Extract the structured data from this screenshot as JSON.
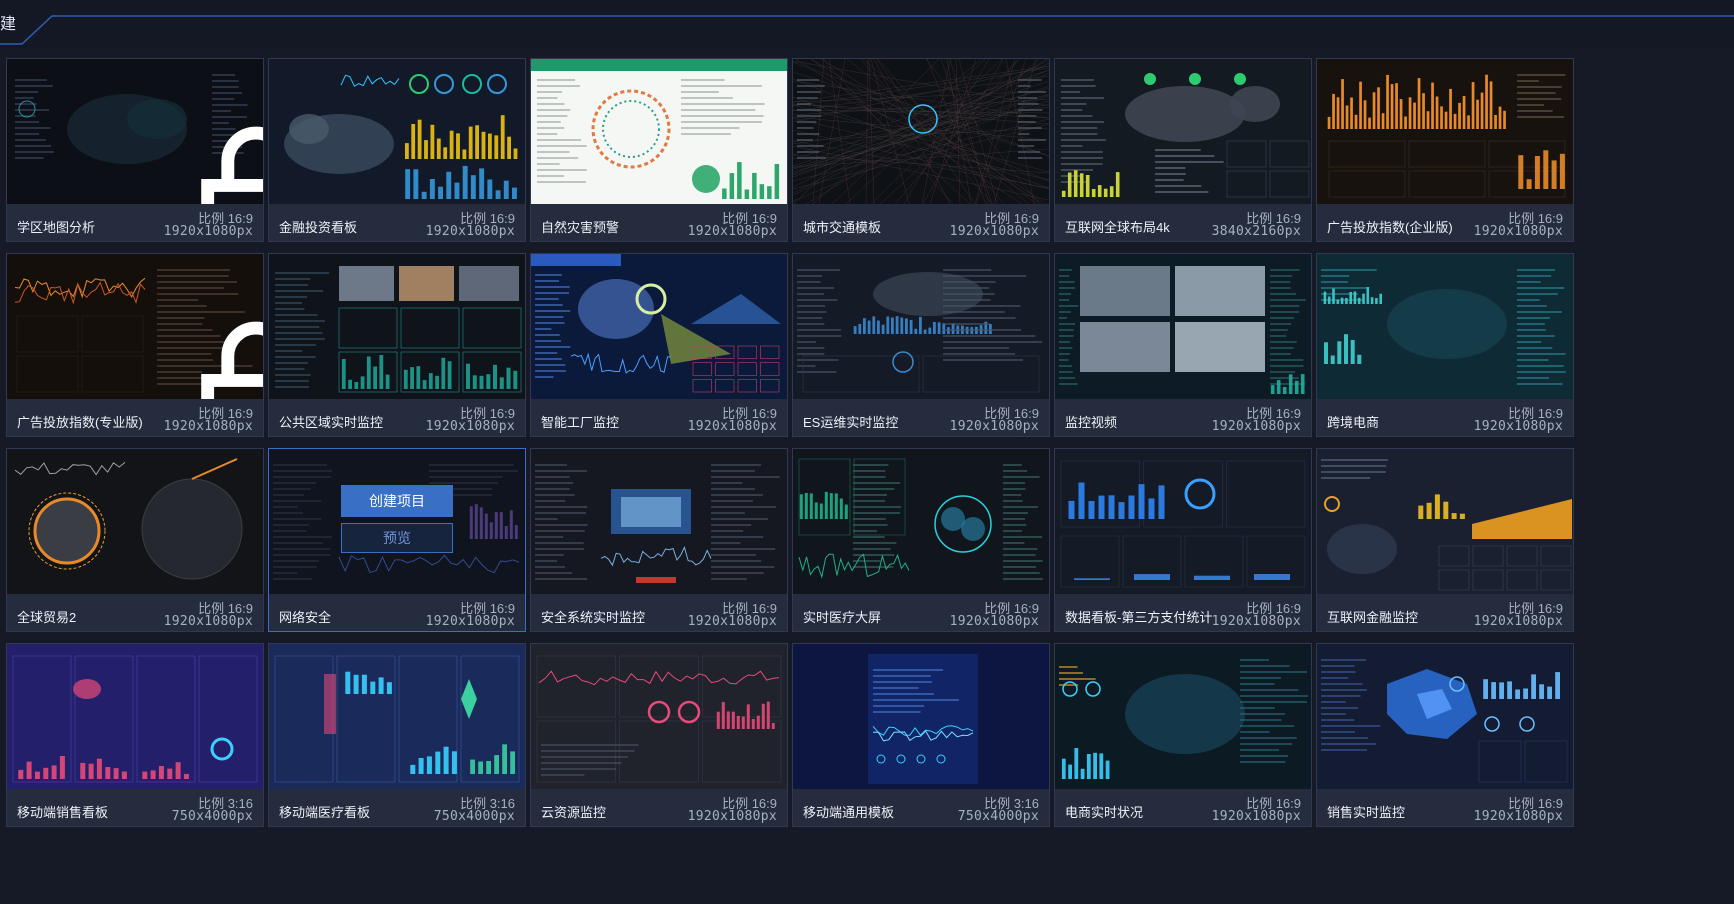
{
  "header": {
    "partial_char": "建"
  },
  "cards": [
    {
      "title": "学区地图分析",
      "ratio": "比例 16:9",
      "size": "1920x1080px",
      "locked": true,
      "theme": "dark-map"
    },
    {
      "title": "金融投资看板",
      "ratio": "比例 16:9",
      "size": "1920x1080px",
      "locked": false,
      "theme": "finance"
    },
    {
      "title": "自然灾害预警",
      "ratio": "比例 16:9",
      "size": "1920x1080px",
      "locked": false,
      "theme": "light-green"
    },
    {
      "title": "城市交通模板",
      "ratio": "比例 16:9",
      "size": "1920x1080px",
      "locked": false,
      "theme": "city-map"
    },
    {
      "title": "互联网全球布局4k",
      "ratio": "比例 16:9",
      "size": "3840x2160px",
      "locked": false,
      "theme": "world-dark"
    },
    {
      "title": "广告投放指数(企业版)",
      "ratio": "比例 16:9",
      "size": "1920x1080px",
      "locked": false,
      "theme": "orange-bars"
    },
    {
      "title": "广告投放指数(专业版)",
      "ratio": "比例 16:9",
      "size": "1920x1080px",
      "locked": true,
      "theme": "orange-line"
    },
    {
      "title": "公共区域实时监控",
      "ratio": "比例 16:9",
      "size": "1920x1080px",
      "locked": false,
      "theme": "cctv"
    },
    {
      "title": "智能工厂监控",
      "ratio": "比例 16:9",
      "size": "1920x1080px",
      "locked": false,
      "theme": "factory"
    },
    {
      "title": "ES运维实时监控",
      "ratio": "比例 16:9",
      "size": "1920x1080px",
      "locked": false,
      "theme": "es-ops"
    },
    {
      "title": "监控视频",
      "ratio": "比例 16:9",
      "size": "1920x1080px",
      "locked": false,
      "theme": "video"
    },
    {
      "title": "跨境电商",
      "ratio": "比例 16:9",
      "size": "1920x1080px",
      "locked": false,
      "theme": "teal-map"
    },
    {
      "title": "全球贸易2",
      "ratio": "比例 16:9",
      "size": "1920x1080px",
      "locked": false,
      "theme": "globe"
    },
    {
      "title": "网络安全",
      "ratio": "比例 16:9",
      "size": "1920x1080px",
      "locked": false,
      "theme": "security",
      "hover": true
    },
    {
      "title": "安全系统实时监控",
      "ratio": "比例 16:9",
      "size": "1920x1080px",
      "locked": false,
      "theme": "secsys"
    },
    {
      "title": "实时医疗大屏",
      "ratio": "比例 16:9",
      "size": "1920x1080px",
      "locked": false,
      "theme": "brain"
    },
    {
      "title": "数据看板-第三方支付统计",
      "ratio": "比例 16:9",
      "size": "1920x1080px",
      "locked": false,
      "theme": "payment"
    },
    {
      "title": "互联网金融监控",
      "ratio": "比例 16:9",
      "size": "1920x1080px",
      "locked": false,
      "theme": "fintech"
    },
    {
      "title": "移动端销售看板",
      "ratio": "比例 3:16",
      "size": "750x4000px",
      "locked": false,
      "theme": "mobile-sales"
    },
    {
      "title": "移动端医疗看板",
      "ratio": "比例 3:16",
      "size": "750x4000px",
      "locked": false,
      "theme": "mobile-med"
    },
    {
      "title": "云资源监控",
      "ratio": "比例 16:9",
      "size": "1920x1080px",
      "locked": false,
      "theme": "cloud"
    },
    {
      "title": "移动端通用模板",
      "ratio": "比例 3:16",
      "size": "750x4000px",
      "locked": false,
      "theme": "mobile-generic"
    },
    {
      "title": "电商实时状况",
      "ratio": "比例 16:9",
      "size": "1920x1080px",
      "locked": false,
      "theme": "ecom"
    },
    {
      "title": "销售实时监控",
      "ratio": "比例 16:9",
      "size": "1920x1080px",
      "locked": false,
      "theme": "china-map"
    }
  ],
  "overlay": {
    "create_label": "创建项目",
    "preview_label": "预览"
  },
  "colors": {
    "accent": "#3a6fc6",
    "background": "#151a26",
    "card": "#1f2535",
    "caption": "#252c3e"
  }
}
